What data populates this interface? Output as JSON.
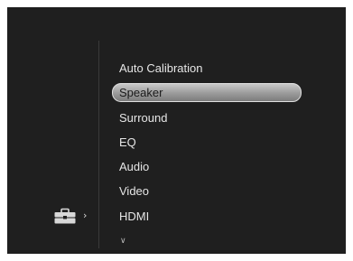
{
  "menu": {
    "items": [
      {
        "label": "Auto Calibration",
        "selected": false
      },
      {
        "label": "Speaker",
        "selected": true
      },
      {
        "label": "Surround",
        "selected": false
      },
      {
        "label": "EQ",
        "selected": false
      },
      {
        "label": "Audio",
        "selected": false
      },
      {
        "label": "Video",
        "selected": false
      },
      {
        "label": "HDMI",
        "selected": false
      }
    ],
    "scroll_indicator_icon": "chevron-down-icon"
  },
  "category": {
    "icon": "toolbox-icon",
    "arrow_icon": "chevron-right-icon"
  },
  "colors": {
    "background": "#1f1f1f",
    "text": "#e6e6e6",
    "highlight": "#a8a8a8"
  }
}
